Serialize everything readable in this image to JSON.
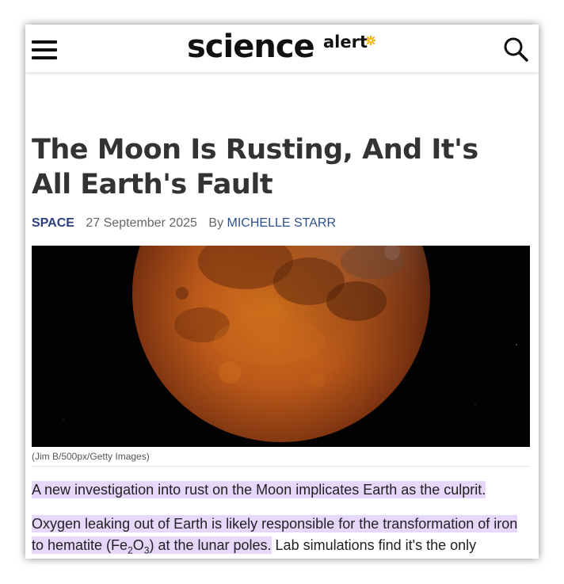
{
  "header": {
    "logo_main": "science",
    "logo_sub": "alert",
    "menu_icon": "hamburger-menu-icon",
    "search_icon": "search-icon",
    "accent": "#f4b400"
  },
  "article": {
    "title": "The Moon Is Rusting, And It's All Earth's Fault",
    "category": "SPACE",
    "date": "27 September 2025",
    "by_label": "By",
    "author": "MICHELLE STARR",
    "image_caption": "(Jim B/500px/Getty Images)",
    "para1": "A new investigation into rust on the Moon implicates Earth as the culprit.",
    "para2_highlighted_a": "Oxygen leaking out of Earth is likely responsible for the transformation of iron to hematite (Fe",
    "para2_sub1": "2",
    "para2_mid": "O",
    "para2_sub2": "3",
    "para2_highlighted_b": ") at the lunar poles.",
    "para2_rest": " Lab simulations find it's the only",
    "category_color": "#2d3e80",
    "highlight_color": "#e6d7fb"
  }
}
